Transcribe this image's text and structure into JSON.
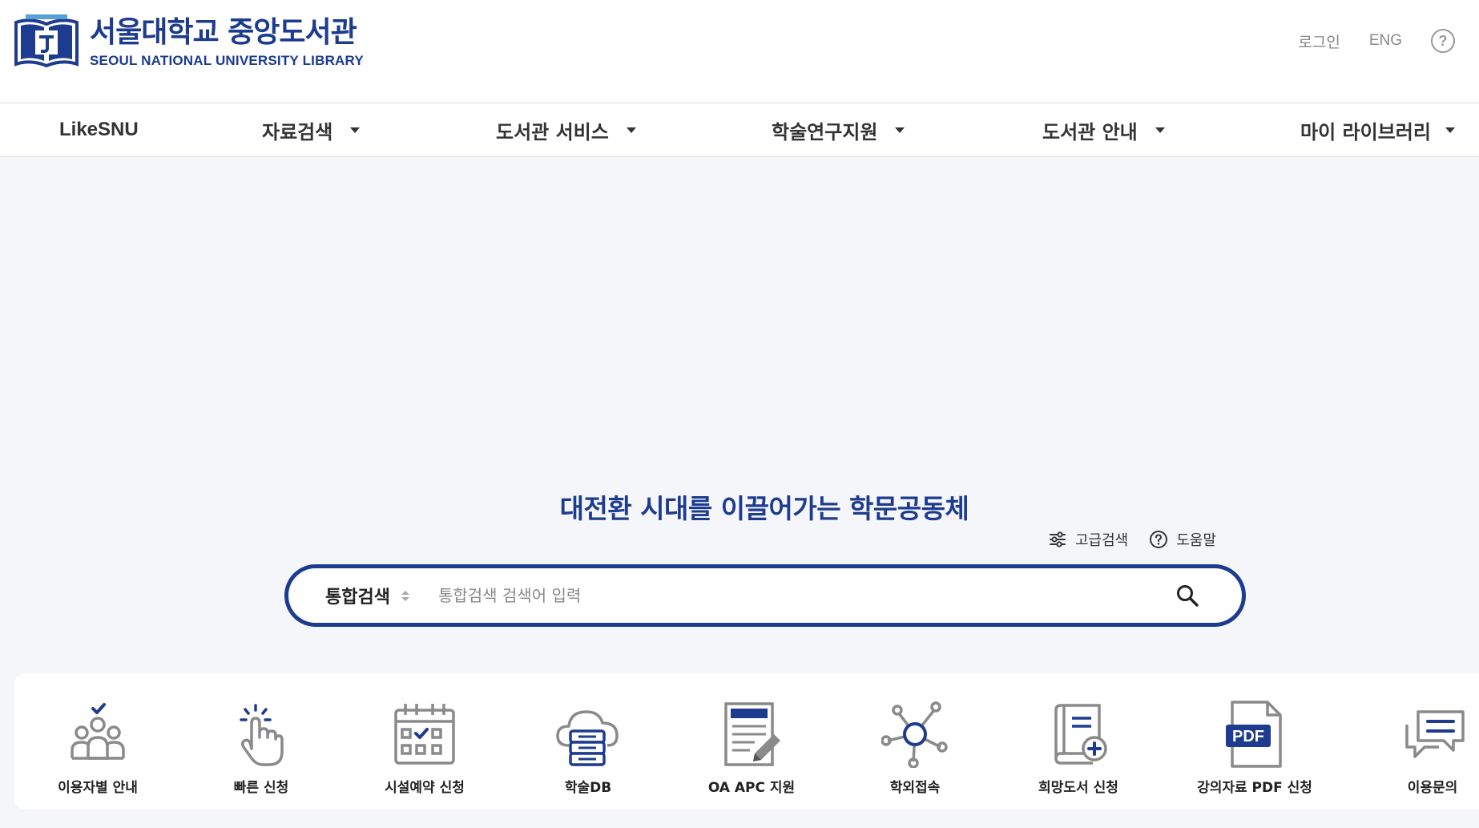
{
  "header": {
    "logo_ko": "서울대학교 중앙도서관",
    "logo_en": "SEOUL NATIONAL UNIVERSITY LIBRARY",
    "login": "로그인",
    "lang": "ENG",
    "help_icon": "question-circle-icon"
  },
  "nav": {
    "items": [
      {
        "label": "LikeSNU",
        "dropdown": false
      },
      {
        "label": "자료검색",
        "dropdown": true
      },
      {
        "label": "도서관 서비스",
        "dropdown": true
      },
      {
        "label": "학술연구지원",
        "dropdown": true
      },
      {
        "label": "도서관 안내",
        "dropdown": true
      },
      {
        "label": "마이 라이브러리",
        "dropdown": true
      }
    ]
  },
  "hero": {
    "slogan": "대전환 시대를 이끌어가는 학문공동체",
    "advanced_search": "고급검색",
    "help": "도움말"
  },
  "search": {
    "scope": "통합검색",
    "placeholder": "통합검색 검색어 입력",
    "value": ""
  },
  "quick_links": [
    {
      "label": "이용자별 안내",
      "icon": "users-check-icon"
    },
    {
      "label": "빠른 신청",
      "icon": "tap-hand-icon"
    },
    {
      "label": "시설예약 신청",
      "icon": "calendar-check-icon"
    },
    {
      "label": "학술DB",
      "icon": "cloud-database-icon"
    },
    {
      "label": "OA APC 지원",
      "icon": "document-edit-icon"
    },
    {
      "label": "학외접속",
      "icon": "network-icon"
    },
    {
      "label": "희망도서 신청",
      "icon": "book-add-icon"
    },
    {
      "label": "강의자료 PDF 신청",
      "icon": "pdf-file-icon"
    },
    {
      "label": "이용문의",
      "icon": "chat-bubbles-icon"
    }
  ],
  "colors": {
    "brand": "#1d3b8f",
    "background": "#f5f6f9",
    "icon_gray": "#8a8a8a"
  }
}
